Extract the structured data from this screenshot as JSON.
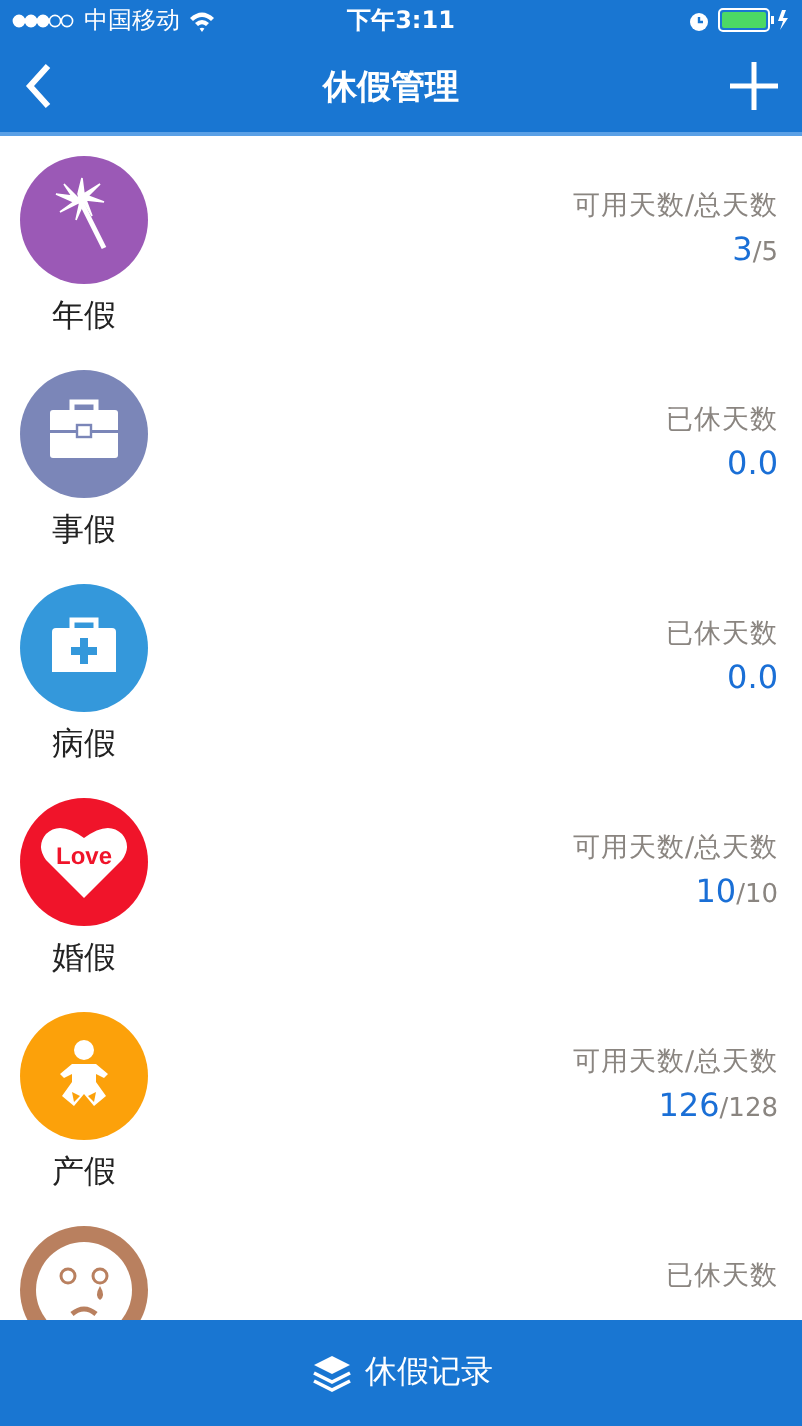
{
  "status_bar": {
    "carrier": "中国移动",
    "time": "下午3:11"
  },
  "nav": {
    "title": "休假管理"
  },
  "leaves": [
    {
      "name": "年假",
      "color": "#9b59b6",
      "kind": "balance",
      "heading": "可用天数/总天数",
      "value": "3",
      "total": "/5"
    },
    {
      "name": "事假",
      "color": "#7b86b8",
      "kind": "used",
      "heading": "已休天数",
      "value": "0.0"
    },
    {
      "name": "病假",
      "color": "#3498db",
      "kind": "used",
      "heading": "已休天数",
      "value": "0.0"
    },
    {
      "name": "婚假",
      "color": "#f0142a",
      "kind": "balance",
      "heading": "可用天数/总天数",
      "value": "10",
      "total": "/10",
      "icon_text": "Love"
    },
    {
      "name": "产假",
      "color": "#fca10a",
      "kind": "balance",
      "heading": "可用天数/总天数",
      "value": "126",
      "total": "/128"
    },
    {
      "color": "#b9805f",
      "kind": "used",
      "heading": "已休天数"
    }
  ],
  "footer": {
    "label": "休假记录"
  }
}
